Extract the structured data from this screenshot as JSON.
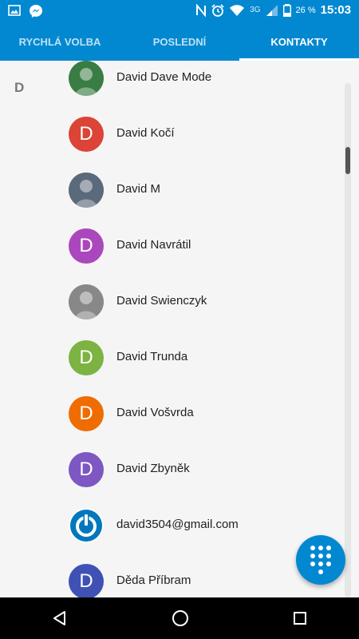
{
  "status_bar": {
    "network": "3G",
    "battery": "26 %",
    "time": "15:03",
    "icons": [
      "gallery-icon",
      "messenger-icon",
      "nfc-icon",
      "alarm-icon",
      "wifi-icon",
      "signal-icon",
      "battery-icon"
    ]
  },
  "tabs": [
    {
      "label": "RYCHLÁ VOLBA",
      "active": false
    },
    {
      "label": "POSLEDNÍ",
      "active": false
    },
    {
      "label": "KONTAKTY",
      "active": true
    }
  ],
  "section_letter": "D",
  "contacts": [
    {
      "name": "David Dave Mode",
      "avatar_type": "photo",
      "initial": "",
      "color": "#3a7d44"
    },
    {
      "name": "David Kočí",
      "avatar_type": "letter",
      "initial": "D",
      "color": "#db4437"
    },
    {
      "name": "David M",
      "avatar_type": "photo",
      "initial": "",
      "color": "#5a6a7a"
    },
    {
      "name": "David Navrátil",
      "avatar_type": "letter",
      "initial": "D",
      "color": "#ab47bc"
    },
    {
      "name": "David Swienczyk",
      "avatar_type": "photo",
      "initial": "",
      "color": "#888888"
    },
    {
      "name": "David Trunda",
      "avatar_type": "letter",
      "initial": "D",
      "color": "#7cb342"
    },
    {
      "name": "David Vošvrda",
      "avatar_type": "letter",
      "initial": "D",
      "color": "#ef6c00"
    },
    {
      "name": "David Zbyněk",
      "avatar_type": "letter",
      "initial": "D",
      "color": "#7e57c2"
    },
    {
      "name": "david3504@gmail.com",
      "avatar_type": "power",
      "initial": "",
      "color": "#0277bd"
    },
    {
      "name": "Děda Příbram",
      "avatar_type": "letter",
      "initial": "D",
      "color": "#3f51b5"
    }
  ],
  "colors": {
    "primary": "#0288d1",
    "background": "#f5f5f5",
    "nav_bar": "#000000"
  },
  "nav": [
    "back-icon",
    "home-icon",
    "recents-icon"
  ],
  "fab_icon": "dialpad-icon"
}
